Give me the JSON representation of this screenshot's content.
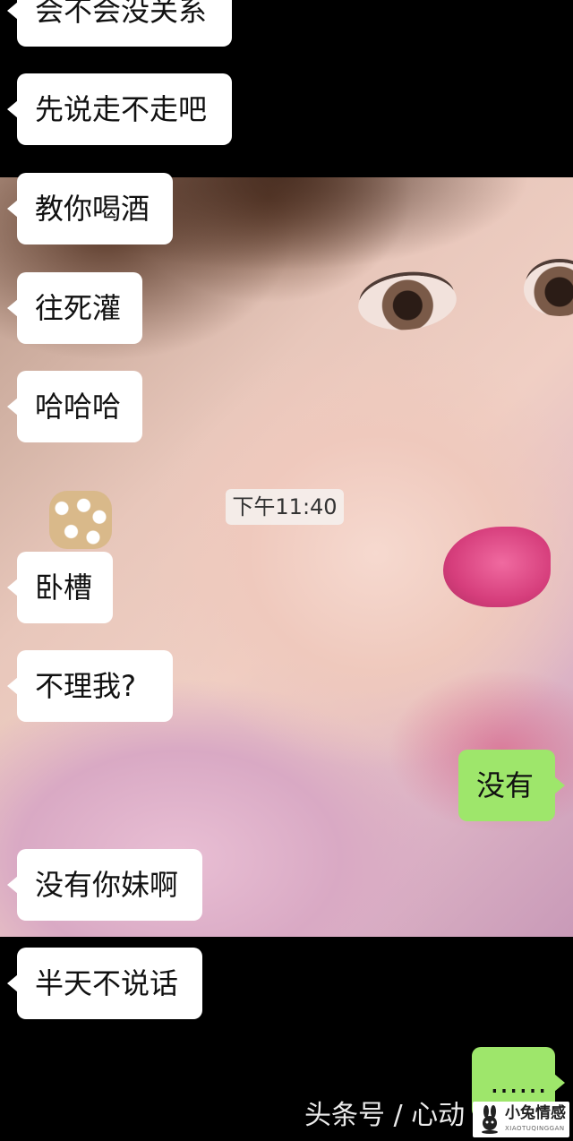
{
  "conversation": {
    "incoming": [
      "会不会没关系",
      "先说走不走吧",
      "教你喝酒",
      "往死灌",
      "哈哈哈",
      "卧槽",
      "不理我?",
      "没有你妹啊",
      "半天不说话"
    ],
    "timestamp": "下午11:40",
    "outgoing": [
      "没有",
      "……"
    ]
  },
  "watermark": {
    "text": "头条号 / 心动",
    "logo_cn": "小兔情感",
    "logo_en": "XIAOTUQINGGAN"
  },
  "colors": {
    "background": "#000000",
    "incoming_bubble": "#ffffff",
    "outgoing_bubble": "#9ee66b"
  }
}
